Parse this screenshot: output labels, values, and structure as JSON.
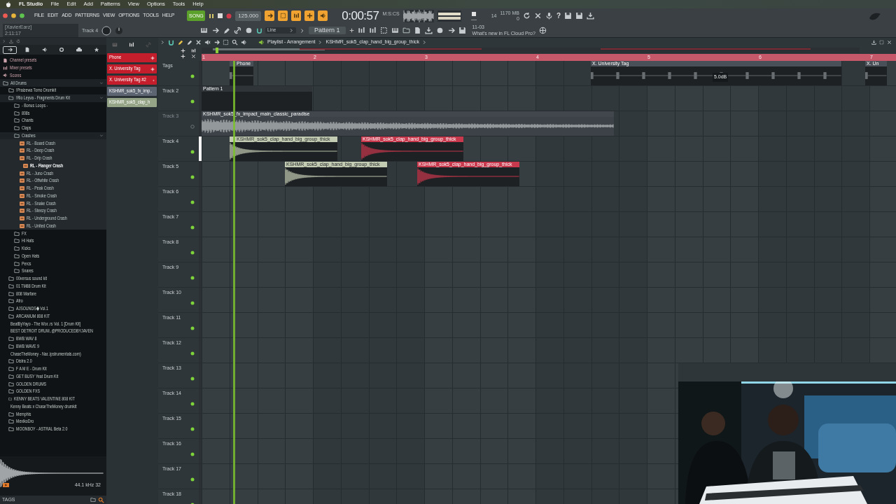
{
  "menubar": {
    "app": "FL Studio",
    "items": [
      "File",
      "Edit",
      "Add",
      "Patterns",
      "View",
      "Options",
      "Tools",
      "Help"
    ]
  },
  "toolbar": {
    "menu": [
      "FILE",
      "EDIT",
      "ADD",
      "PATTERNS",
      "VIEW",
      "OPTIONS",
      "TOOLS",
      "HELP"
    ],
    "mode": {
      "label": "SONG",
      "on": true
    },
    "tempo": "125.000",
    "time": "0:00:57",
    "time_unit": "M:S:CS",
    "cpu": "14",
    "memory": "1170 MB",
    "polyphony": "0",
    "help": "?",
    "hint_title": "[XavierEarz]",
    "hint_value": "2:11:17",
    "target": "Track 4",
    "snap": "Line",
    "pattern": "Pattern 1",
    "news_date": "11-03",
    "news": "What's new in FL Cloud Pro?"
  },
  "browser": {
    "tabs": [
      {
        "selected": true
      },
      {
        "selected": false
      },
      {
        "selected": false
      },
      {
        "selected": false
      },
      {
        "selected": false
      },
      {
        "selected": false
      }
    ],
    "tree": [
      {
        "label": "Channel presets",
        "kind": "preset"
      },
      {
        "label": "Mixer presets",
        "kind": "preset"
      },
      {
        "label": "Scores",
        "kind": "preset"
      },
      {
        "label": "All Drums",
        "kind": "folder",
        "expanded": true,
        "children": [
          {
            "label": "!Praizewa Tomo Drumkit",
            "kind": "folder",
            "expanded": false
          },
          {
            "label": "!Rio Leyva - Fragments Drum Kit",
            "kind": "folder",
            "expanded": true,
            "children": [
              {
                "label": "- Bonus Loops -",
                "kind": "folder",
                "expanded": false
              },
              {
                "label": "808s",
                "kind": "folder",
                "expanded": false
              },
              {
                "label": "Chants",
                "kind": "folder",
                "expanded": false
              },
              {
                "label": "Claps",
                "kind": "folder",
                "expanded": false
              },
              {
                "label": "Crashes",
                "kind": "folder",
                "expanded": true,
                "children": [
                  {
                    "label": "RL - Board Crash",
                    "kind": "file",
                    "selected": false
                  },
                  {
                    "label": "RL - Deep Crash",
                    "kind": "file",
                    "selected": false
                  },
                  {
                    "label": "RL - Drip Crash",
                    "kind": "file",
                    "selected": false
                  },
                  {
                    "label": "RL - Flanger Crash",
                    "kind": "file",
                    "selected": true
                  },
                  {
                    "label": "RL - Juno Crash",
                    "kind": "file",
                    "selected": false
                  },
                  {
                    "label": "RL - Offwhite Crash",
                    "kind": "file",
                    "selected": false
                  },
                  {
                    "label": "RL - Peak Crash",
                    "kind": "file",
                    "selected": false
                  },
                  {
                    "label": "RL - Smoke Crash",
                    "kind": "file",
                    "selected": false
                  },
                  {
                    "label": "RL - Snake Crash",
                    "kind": "file",
                    "selected": false
                  },
                  {
                    "label": "RL - Steezy Crash",
                    "kind": "file",
                    "selected": false
                  },
                  {
                    "label": "RL - Underground Crash",
                    "kind": "file",
                    "selected": false
                  },
                  {
                    "label": "RL - United Crash",
                    "kind": "file",
                    "selected": false
                  }
                ]
              },
              {
                "label": "FX",
                "kind": "folder",
                "expanded": false
              },
              {
                "label": "Hi Hats",
                "kind": "folder",
                "expanded": false
              },
              {
                "label": "Kicks",
                "kind": "folder",
                "expanded": false
              },
              {
                "label": "Open Hats",
                "kind": "folder",
                "expanded": false
              },
              {
                "label": "Percs",
                "kind": "folder",
                "expanded": false
              },
              {
                "label": "Snares",
                "kind": "folder",
                "expanded": false
              }
            ]
          },
          {
            "label": "00versus sound kit",
            "kind": "folder",
            "expanded": false
          },
          {
            "label": "01 TM88 Drum Kit",
            "kind": "folder",
            "expanded": false
          },
          {
            "label": "808 Warfare",
            "kind": "folder",
            "expanded": false
          },
          {
            "label": "Afro",
            "kind": "folder",
            "expanded": false
          },
          {
            "label": "AJSOUNDS◆ Vol.1",
            "kind": "folder",
            "expanded": false
          },
          {
            "label": "ARCANIUM 808 KIT",
            "kind": "folder",
            "expanded": false
          },
          {
            "label": "BeatByYayo - The Wor..rs Vol. 1 [Drum Kit]",
            "kind": "folder",
            "expanded": false
          },
          {
            "label": "BEST DETROIT DRUM..@PRODUCEDBYJAVEN",
            "kind": "folder",
            "expanded": false
          },
          {
            "label": "BWB WAV 8",
            "kind": "folder",
            "expanded": false
          },
          {
            "label": "BWB WAVE 9",
            "kind": "folder",
            "expanded": false
          },
          {
            "label": "ChaseTheMoney - Nar..ipstrumentals.com)",
            "kind": "folder",
            "expanded": false
          },
          {
            "label": "Distra 2.0",
            "kind": "folder",
            "expanded": false
          },
          {
            "label": "F A M E - Drum Kit",
            "kind": "folder",
            "expanded": false
          },
          {
            "label": "GET BUSY Yeat Drum Kit",
            "kind": "folder",
            "expanded": false
          },
          {
            "label": "GOLDEN DRUMS",
            "kind": "folder",
            "expanded": false
          },
          {
            "label": "GOLDEN FXS",
            "kind": "folder",
            "expanded": false
          },
          {
            "label": "KENNY BEATS VALENTINE 808 KIT",
            "kind": "folder",
            "expanded": false
          },
          {
            "label": "Kenny Beats x ChaseTheMoney drumkit",
            "kind": "folder",
            "expanded": false
          },
          {
            "label": "Memphis",
            "kind": "folder",
            "expanded": false
          },
          {
            "label": "MexikoDro",
            "kind": "folder",
            "expanded": false
          },
          {
            "label": "MOONBOY - ASTRAL Beta 2.0",
            "kind": "folder",
            "expanded": false
          }
        ]
      }
    ],
    "preview_info": "44.1 kHz 32",
    "tags_label": "TAGS"
  },
  "picker": [
    {
      "name": "Phone",
      "color": "#c41e2c"
    },
    {
      "name": "X. University Tag",
      "color": "#c41e2c"
    },
    {
      "name": "X. University Tag #2",
      "color": "#c41e2c"
    },
    {
      "name": "KSHMR_sok5_fx_imp..",
      "color": "#5e6572"
    },
    {
      "name": "KSHMR_sok5_clap_h",
      "color": "#95a487"
    }
  ],
  "playlist": {
    "title": "Playlist - Arrangement",
    "source": "KSHMR_sok5_clap_hand_big_group_thick",
    "bars": [
      "1",
      "2",
      "3",
      "4",
      "5",
      "6",
      "7"
    ],
    "tracks": [
      {
        "label": "Tags",
        "selected": false,
        "muted": false,
        "clips": [
          {
            "kind": "audio",
            "name": "Phone",
            "color": "#4a5057"
          },
          {
            "kind": "audio",
            "name": "X. University Tag",
            "color": "#4a5057",
            "tooltip": "5.0dB"
          },
          {
            "kind": "audio",
            "name": "X. Un",
            "color": "#4a5057"
          }
        ]
      },
      {
        "label": "Track 2",
        "selected": false,
        "muted": false,
        "clips": [
          {
            "kind": "pattern",
            "name": "Pattern 1",
            "color": "#2e3438"
          }
        ]
      },
      {
        "label": "Track 3",
        "selected": false,
        "muted": true,
        "clips": [
          {
            "kind": "audio",
            "name": "KSHMR_sok5_fx_impact_main_classic_paradise",
            "color": "#41474d"
          }
        ]
      },
      {
        "label": "Track 4",
        "selected": true,
        "muted": false,
        "clips": [
          {
            "kind": "audio",
            "name": "KSHMR_sok5_clap_hand_big_group_thick",
            "color": "#c3cbb2"
          },
          {
            "kind": "audio",
            "name": "KSHMR_sok5_clap_hand_big_group_thick",
            "color": "#c8394d"
          }
        ]
      },
      {
        "label": "Track 5",
        "selected": false,
        "muted": false,
        "clips": [
          {
            "kind": "audio",
            "name": "KSHMR_sok5_clap_hand_big_group_thick",
            "color": "#c3cbb2"
          },
          {
            "kind": "audio",
            "name": "KSHMR_sok5_clap_hand_big_group_thick",
            "color": "#c8394d"
          }
        ]
      },
      {
        "label": "Track 6",
        "selected": false,
        "muted": false
      },
      {
        "label": "Track 7",
        "selected": false,
        "muted": false
      },
      {
        "label": "Track 8",
        "selected": false,
        "muted": false
      },
      {
        "label": "Track 9",
        "selected": false,
        "muted": false
      },
      {
        "label": "Track 10",
        "selected": false,
        "muted": false
      },
      {
        "label": "Track 11",
        "selected": false,
        "muted": false
      },
      {
        "label": "Track 12",
        "selected": false,
        "muted": false
      },
      {
        "label": "Track 13",
        "selected": false,
        "muted": false
      },
      {
        "label": "Track 14",
        "selected": false,
        "muted": false
      },
      {
        "label": "Track 15",
        "selected": false,
        "muted": false
      },
      {
        "label": "Track 16",
        "selected": false,
        "muted": false
      },
      {
        "label": "Track 17",
        "selected": false,
        "muted": false
      },
      {
        "label": "Track 18",
        "selected": false,
        "muted": false
      }
    ]
  }
}
